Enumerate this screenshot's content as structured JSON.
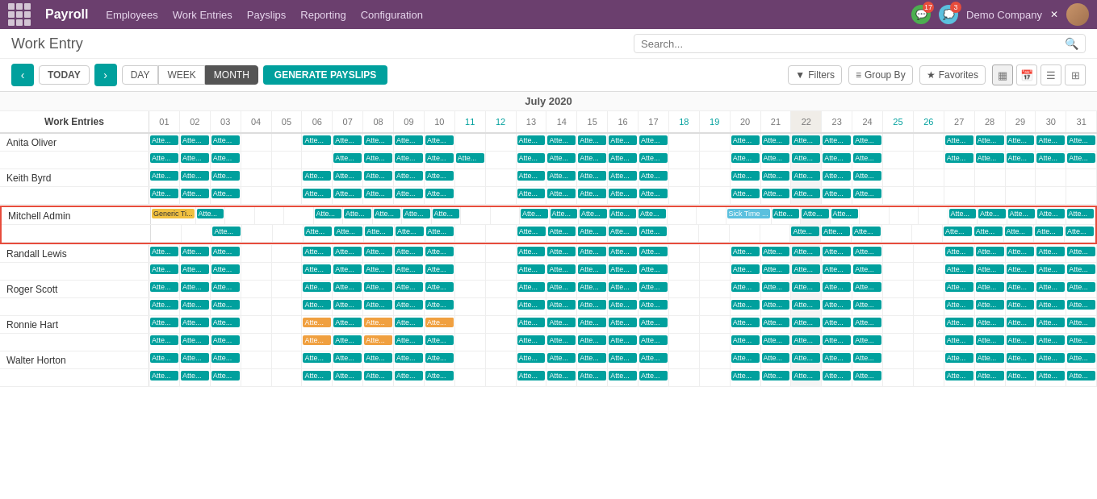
{
  "app": {
    "title": "Payroll",
    "grid_icon": "grid-icon"
  },
  "topnav": {
    "items": [
      {
        "label": "Employees",
        "active": false
      },
      {
        "label": "Work Entries",
        "active": false
      },
      {
        "label": "Payslips",
        "active": false
      },
      {
        "label": "Reporting",
        "active": false
      },
      {
        "label": "Configuration",
        "active": false
      }
    ]
  },
  "topright": {
    "badge1_count": "17",
    "badge2_count": "3",
    "company": "Demo Company"
  },
  "page": {
    "title": "Work Entry",
    "search_placeholder": "Search..."
  },
  "toolbar": {
    "prev_label": "‹",
    "next_label": "›",
    "today_label": "TODAY",
    "day_label": "DAY",
    "week_label": "WEEK",
    "month_label": "MONTH",
    "generate_label": "GENERATE PAYSLIPS",
    "filters_label": "Filters",
    "groupby_label": "Group By",
    "favorites_label": "Favorites"
  },
  "calendar": {
    "month_title": "July 2020",
    "col_header_label": "Work Entries",
    "days": [
      {
        "num": "01",
        "weekend": false
      },
      {
        "num": "02",
        "weekend": false
      },
      {
        "num": "03",
        "weekend": false
      },
      {
        "num": "04",
        "weekend": false
      },
      {
        "num": "05",
        "weekend": false
      },
      {
        "num": "06",
        "weekend": false
      },
      {
        "num": "07",
        "weekend": false
      },
      {
        "num": "08",
        "weekend": false
      },
      {
        "num": "09",
        "weekend": false
      },
      {
        "num": "10",
        "weekend": false
      },
      {
        "num": "11",
        "weekend": true
      },
      {
        "num": "12",
        "weekend": true
      },
      {
        "num": "13",
        "weekend": false
      },
      {
        "num": "14",
        "weekend": false
      },
      {
        "num": "15",
        "weekend": false
      },
      {
        "num": "16",
        "weekend": false
      },
      {
        "num": "17",
        "weekend": false
      },
      {
        "num": "18",
        "weekend": true
      },
      {
        "num": "19",
        "weekend": true
      },
      {
        "num": "20",
        "weekend": false
      },
      {
        "num": "21",
        "weekend": false
      },
      {
        "num": "22",
        "weekend": false,
        "today": true
      },
      {
        "num": "23",
        "weekend": false
      },
      {
        "num": "24",
        "weekend": false
      },
      {
        "num": "25",
        "weekend": true
      },
      {
        "num": "26",
        "weekend": true
      },
      {
        "num": "27",
        "weekend": false
      },
      {
        "num": "28",
        "weekend": false
      },
      {
        "num": "29",
        "weekend": false
      },
      {
        "num": "30",
        "weekend": false
      },
      {
        "num": "31",
        "weekend": false
      }
    ],
    "employees": [
      {
        "name": "Anita Oliver",
        "rows": [
          [
            1,
            1,
            1,
            0,
            0,
            1,
            1,
            1,
            1,
            1,
            0,
            0,
            1,
            1,
            1,
            1,
            1,
            0,
            0,
            1,
            1,
            1,
            1,
            1,
            0,
            0,
            1,
            1,
            1,
            1,
            1
          ],
          [
            1,
            1,
            1,
            0,
            0,
            0,
            1,
            1,
            1,
            1,
            1,
            0,
            1,
            1,
            1,
            1,
            1,
            0,
            0,
            1,
            1,
            1,
            1,
            1,
            0,
            0,
            1,
            1,
            1,
            1,
            1
          ]
        ]
      },
      {
        "name": "Keith Byrd",
        "rows": [
          [
            1,
            1,
            1,
            0,
            0,
            1,
            1,
            1,
            1,
            1,
            0,
            0,
            1,
            1,
            1,
            1,
            1,
            0,
            0,
            1,
            1,
            1,
            1,
            1,
            0,
            0,
            0,
            0,
            0,
            0,
            0
          ],
          [
            1,
            1,
            1,
            0,
            0,
            1,
            1,
            1,
            1,
            1,
            0,
            0,
            1,
            1,
            1,
            1,
            1,
            0,
            0,
            1,
            1,
            1,
            1,
            1,
            0,
            0,
            0,
            0,
            0,
            0,
            0
          ]
        ]
      },
      {
        "name": "Mitchell Admin",
        "highlighted": true,
        "rows": [
          [
            2,
            1,
            0,
            0,
            0,
            1,
            1,
            1,
            1,
            1,
            0,
            0,
            1,
            1,
            1,
            1,
            1,
            0,
            0,
            3,
            1,
            1,
            1,
            0,
            0,
            0,
            1,
            1,
            1,
            1,
            1
          ],
          [
            0,
            0,
            1,
            0,
            0,
            1,
            1,
            1,
            1,
            1,
            0,
            0,
            1,
            1,
            1,
            1,
            1,
            0,
            0,
            0,
            0,
            1,
            1,
            1,
            0,
            0,
            1,
            1,
            1,
            1,
            1
          ]
        ]
      },
      {
        "name": "Randall Lewis",
        "rows": [
          [
            1,
            1,
            1,
            0,
            0,
            1,
            1,
            1,
            1,
            1,
            0,
            0,
            1,
            1,
            1,
            1,
            1,
            0,
            0,
            1,
            1,
            1,
            1,
            1,
            0,
            0,
            1,
            1,
            1,
            1,
            1
          ],
          [
            1,
            1,
            1,
            0,
            0,
            1,
            1,
            1,
            1,
            1,
            0,
            0,
            1,
            1,
            1,
            1,
            1,
            0,
            0,
            1,
            1,
            1,
            1,
            1,
            0,
            0,
            1,
            1,
            1,
            1,
            1
          ]
        ]
      },
      {
        "name": "Roger Scott",
        "rows": [
          [
            1,
            1,
            1,
            0,
            0,
            1,
            1,
            1,
            1,
            1,
            0,
            0,
            1,
            1,
            1,
            1,
            1,
            0,
            0,
            1,
            1,
            1,
            1,
            1,
            0,
            0,
            1,
            1,
            1,
            1,
            1
          ],
          [
            1,
            1,
            1,
            0,
            0,
            1,
            1,
            1,
            1,
            1,
            0,
            0,
            1,
            1,
            1,
            1,
            1,
            0,
            0,
            1,
            1,
            1,
            1,
            1,
            0,
            0,
            1,
            1,
            1,
            1,
            1
          ]
        ]
      },
      {
        "name": "Ronnie Hart",
        "rows": [
          [
            1,
            1,
            1,
            0,
            0,
            4,
            1,
            4,
            1,
            4,
            0,
            0,
            1,
            1,
            1,
            1,
            1,
            0,
            0,
            1,
            1,
            1,
            1,
            1,
            0,
            0,
            1,
            1,
            1,
            1,
            1
          ],
          [
            1,
            1,
            1,
            0,
            0,
            4,
            1,
            4,
            1,
            1,
            0,
            0,
            1,
            1,
            1,
            1,
            1,
            0,
            0,
            1,
            1,
            1,
            1,
            1,
            0,
            0,
            1,
            1,
            1,
            1,
            1
          ]
        ]
      },
      {
        "name": "Walter Horton",
        "rows": [
          [
            1,
            1,
            1,
            0,
            0,
            1,
            1,
            1,
            1,
            1,
            0,
            0,
            1,
            1,
            1,
            1,
            1,
            0,
            0,
            1,
            1,
            1,
            1,
            1,
            0,
            0,
            1,
            1,
            1,
            1,
            1
          ],
          [
            1,
            1,
            1,
            0,
            0,
            1,
            1,
            1,
            1,
            1,
            0,
            0,
            1,
            1,
            1,
            1,
            1,
            0,
            0,
            1,
            1,
            1,
            1,
            1,
            0,
            0,
            1,
            1,
            1,
            1,
            1
          ]
        ]
      }
    ],
    "cell_labels": {
      "1": "Atte...",
      "2": "Generic Ti...",
      "3": "Sick Time ...",
      "4": "Atte..."
    }
  }
}
